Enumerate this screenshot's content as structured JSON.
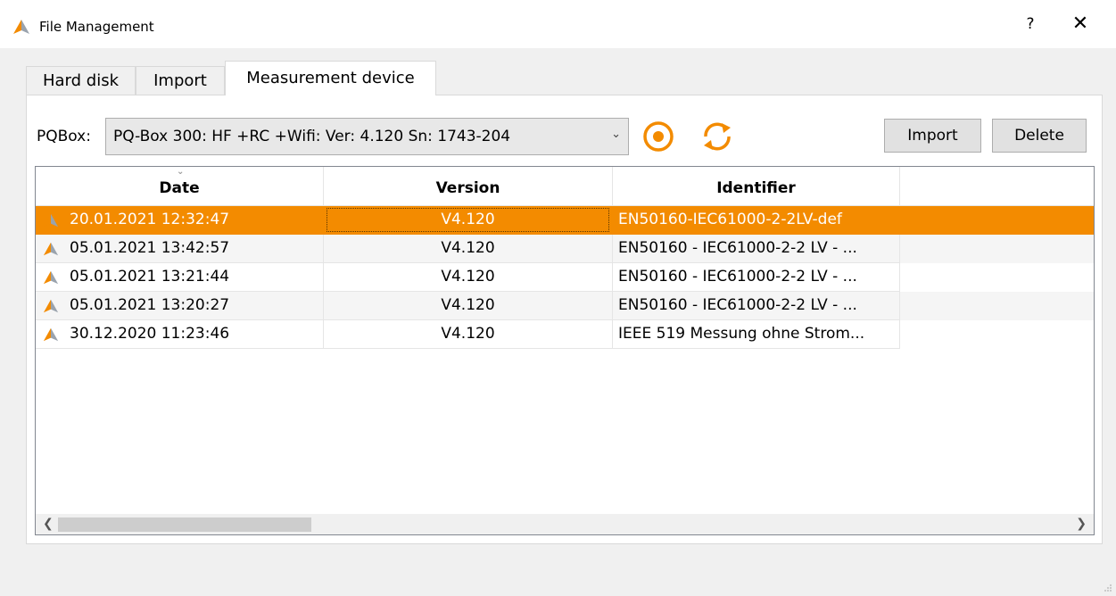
{
  "window": {
    "title": "File Management",
    "help_label": "?",
    "close_label": "✕"
  },
  "tabs": [
    {
      "label": "Hard disk",
      "active": false
    },
    {
      "label": "Import",
      "active": false
    },
    {
      "label": "Measurement device",
      "active": true
    }
  ],
  "device": {
    "label": "PQBox:",
    "selected": "PQ-Box 300: HF +RC +Wifi: Ver: 4.120 Sn: 1743-204"
  },
  "buttons": {
    "import": "Import",
    "delete": "Delete"
  },
  "table": {
    "columns": [
      "Date",
      "Version",
      "Identifier"
    ],
    "rows": [
      {
        "date": "20.01.2021 12:32:47",
        "version": "V4.120",
        "identifier": "EN50160-IEC61000-2-2LV-def",
        "selected": true
      },
      {
        "date": "05.01.2021 13:42:57",
        "version": "V4.120",
        "identifier": "EN50160 - IEC61000-2-2 LV - ..."
      },
      {
        "date": "05.01.2021 13:21:44",
        "version": "V4.120",
        "identifier": "EN50160 - IEC61000-2-2 LV - ..."
      },
      {
        "date": "05.01.2021 13:20:27",
        "version": "V4.120",
        "identifier": "EN50160 - IEC61000-2-2 LV - ..."
      },
      {
        "date": "30.12.2020 11:23:46",
        "version": "V4.120",
        "identifier": "IEEE 519 Messung ohne Strom..."
      }
    ]
  },
  "colors": {
    "accent": "#f38b00",
    "selection_text": "#ffffff"
  },
  "icons": {
    "app": "app-logo-icon",
    "record": "record-icon",
    "refresh": "refresh-icon",
    "row": "measurement-file-icon"
  }
}
